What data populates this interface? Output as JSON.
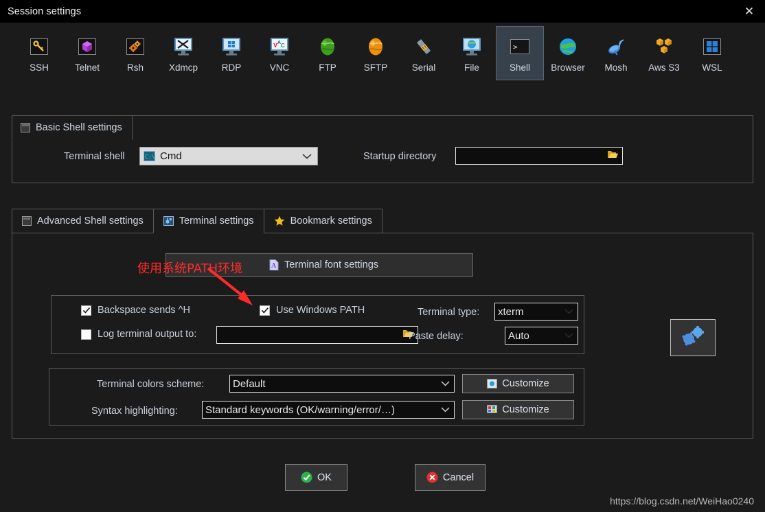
{
  "window": {
    "title": "Session settings",
    "close_label": "✕"
  },
  "toolbar": {
    "items": [
      {
        "label": "SSH",
        "icon": "ssh-key-icon",
        "selected": false
      },
      {
        "label": "Telnet",
        "icon": "telnet-cube-icon",
        "selected": false
      },
      {
        "label": "Rsh",
        "icon": "rsh-gears-icon",
        "selected": false
      },
      {
        "label": "Xdmcp",
        "icon": "xdmcp-monitor-icon",
        "selected": false
      },
      {
        "label": "RDP",
        "icon": "rdp-windows-icon",
        "selected": false
      },
      {
        "label": "VNC",
        "icon": "vnc-monitor-icon",
        "selected": false
      },
      {
        "label": "FTP",
        "icon": "ftp-globe-icon",
        "selected": false
      },
      {
        "label": "SFTP",
        "icon": "sftp-globe-icon",
        "selected": false
      },
      {
        "label": "Serial",
        "icon": "serial-plug-icon",
        "selected": false
      },
      {
        "label": "File",
        "icon": "file-monitor-icon",
        "selected": false
      },
      {
        "label": "Shell",
        "icon": "shell-prompt-icon",
        "selected": true
      },
      {
        "label": "Browser",
        "icon": "browser-globe-icon",
        "selected": false
      },
      {
        "label": "Mosh",
        "icon": "mosh-dish-icon",
        "selected": false
      },
      {
        "label": "Aws S3",
        "icon": "aws-s3-cubes-icon",
        "selected": false
      },
      {
        "label": "WSL",
        "icon": "wsl-windows-icon",
        "selected": false
      }
    ]
  },
  "basic_shell": {
    "tab_label": "Basic Shell settings",
    "terminal_shell_label": "Terminal shell",
    "terminal_shell_value": "Cmd",
    "startup_directory_label": "Startup directory",
    "startup_directory_value": "",
    "startup_directory_placeholder": ""
  },
  "tabs": [
    {
      "label": "Advanced Shell settings",
      "icon": "window-icon",
      "active": false
    },
    {
      "label": "Terminal settings",
      "icon": "terminal-settings-icon",
      "active": true
    },
    {
      "label": "Bookmark settings",
      "icon": "star-icon",
      "active": false
    }
  ],
  "terminal_settings": {
    "font_group_label": "Terminal font settings",
    "backspace_label": "Backspace sends ^H",
    "backspace_checked": true,
    "use_windows_path_label": "Use Windows PATH",
    "use_windows_path_checked": true,
    "log_output_label": "Log terminal output to:",
    "log_output_checked": false,
    "log_output_value": "",
    "terminal_type_label": "Terminal type:",
    "terminal_type_value": "xterm",
    "paste_delay_label": "Paste delay:",
    "paste_delay_value": "Auto",
    "colors_scheme_label": "Terminal colors scheme:",
    "colors_scheme_value": "Default",
    "colors_customize_label": "Customize",
    "syntax_label": "Syntax highlighting:",
    "syntax_value": "Standard keywords (OK/warning/error/…)",
    "syntax_customize_label": "Customize",
    "gear_button_name": "terminal-advanced-settings"
  },
  "annotation": {
    "text": "使用系统PATH环境",
    "color": "#ff2a2a"
  },
  "buttons": {
    "ok_label": "OK",
    "cancel_label": "Cancel"
  },
  "footer": {
    "url": "https://blog.csdn.net/WeiHao0240"
  },
  "colors": {
    "background": "#1b1b1b",
    "titlebar": "#000000",
    "selection": "#37414c",
    "text": "#c8d2dc",
    "annotation_red": "#ff2a2a",
    "ok_green": "#2db24a",
    "cancel_red": "#e03030"
  }
}
